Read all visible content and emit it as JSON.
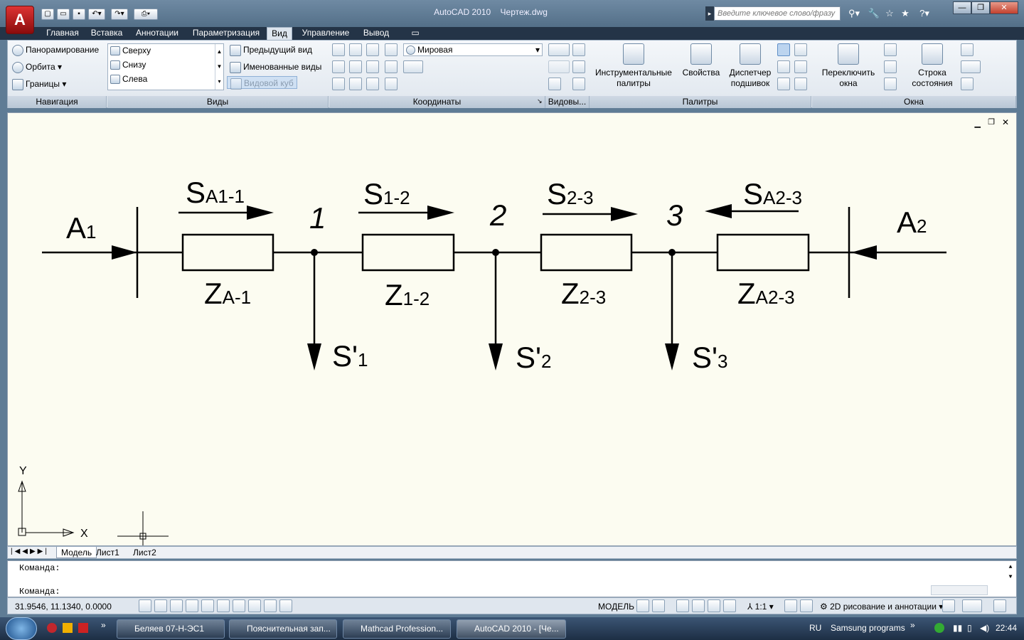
{
  "title": {
    "app": "AutoCAD 2010",
    "document": "Чертеж.dwg"
  },
  "search": {
    "placeholder": "Введите ключевое слово/фразу"
  },
  "ribbon_tabs": [
    "Главная",
    "Вставка",
    "Аннотации",
    "Параметризация",
    "Вид",
    "Управление",
    "Вывод"
  ],
  "navigation": {
    "pan": "Панорамирование",
    "orbit": "Орбита",
    "extents": "Границы",
    "label": "Навигация"
  },
  "views": {
    "list": [
      "Сверху",
      "Снизу",
      "Слева"
    ],
    "previous": "Предыдущий вид",
    "named": "Именованные виды",
    "viewcube": "Видовой куб",
    "label": "Виды"
  },
  "coordinates": {
    "ucs": "Мировая",
    "label": "Координаты"
  },
  "viewports": {
    "label": "Видовы..."
  },
  "palettes": {
    "tool_palettes": "Инструментальные палитры",
    "properties": "Свойства",
    "sheet_set": "Диспетчер подшивок",
    "label": "Палитры"
  },
  "windows": {
    "switch": "Переключить окна",
    "status_bar": "Строка состояния",
    "label": "Окна"
  },
  "drawing": {
    "sources": [
      {
        "main": "A",
        "sub": "1"
      },
      {
        "main": "A",
        "sub": "2"
      }
    ],
    "flows": [
      {
        "main": "S",
        "sub": "A1-1"
      },
      {
        "main": "S",
        "sub": "1-2"
      },
      {
        "main": "S",
        "sub": "2-3"
      },
      {
        "main": "S",
        "sub": "A2-3"
      }
    ],
    "nodes": [
      "1",
      "2",
      "3"
    ],
    "impedances": [
      {
        "main": "Z",
        "sub": "A-1"
      },
      {
        "main": "Z",
        "sub": "1-2"
      },
      {
        "main": "Z",
        "sub": "2-3"
      },
      {
        "main": "Z",
        "sub": "A2-3"
      }
    ],
    "loads": [
      {
        "main": "S'",
        "sub": "1"
      },
      {
        "main": "S'",
        "sub": "2"
      },
      {
        "main": "S'",
        "sub": "3"
      }
    ],
    "ucs_x": "X",
    "ucs_y": "Y"
  },
  "layout_tabs": [
    "Модель",
    "Лист1",
    "Лист2"
  ],
  "command": {
    "line1": "Команда:",
    "line2": "Команда:"
  },
  "status": {
    "coords": "31.9546, 11.1340, 0.0000",
    "model": "МОДЕЛЬ",
    "scale": "1:1",
    "workspace": "2D рисование и аннотации"
  },
  "taskbar": {
    "items": [
      "Беляев 07-Н-ЭС1",
      "Пояснительная зап...",
      "Mathcad Profession...",
      "AutoCAD 2010 - [Че..."
    ],
    "lang": "RU",
    "programs": "Samsung programs",
    "clock": "22:44"
  }
}
